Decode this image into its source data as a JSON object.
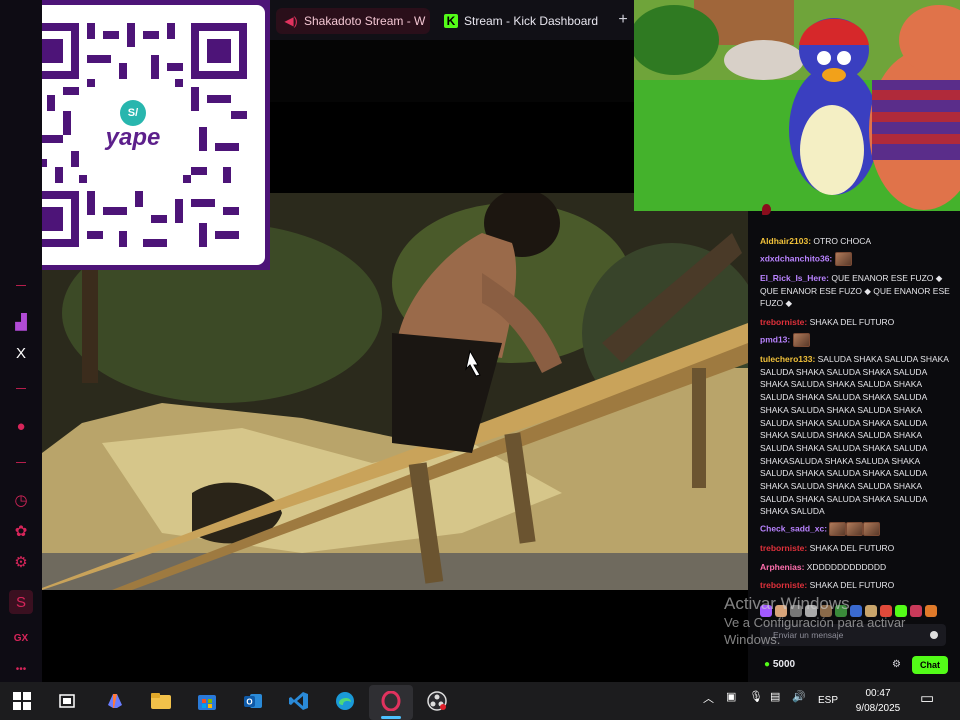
{
  "browser": {
    "tabs": [
      {
        "label": "Shakadoto Stream - W",
        "icon": "speaker-icon",
        "active": true
      },
      {
        "label": "Stream - Kick Dashboard",
        "icon": "kick-icon",
        "active": false
      }
    ],
    "new_tab_symbol": "+",
    "sidebar": {
      "items": [
        {
          "icon": "twitch-icon",
          "symbol": "▟"
        },
        {
          "icon": "x-icon",
          "symbol": "𝕏"
        },
        {
          "icon": "record-icon",
          "symbol": "●"
        },
        {
          "icon": "history-icon",
          "symbol": "◷"
        },
        {
          "icon": "extensions-icon",
          "symbol": "✿"
        },
        {
          "icon": "settings-icon",
          "symbol": "⚙"
        },
        {
          "icon": "gx-corner-icon",
          "symbol": "S"
        },
        {
          "icon": "gx-icon",
          "symbol": "GX"
        },
        {
          "icon": "more-icon",
          "symbol": "•••"
        }
      ]
    }
  },
  "qr_overlay": {
    "brand": "yape",
    "badge_initials": "S/"
  },
  "chat": {
    "messages": [
      {
        "user": "Aldhair2103:",
        "text": " OTRO CHOCA",
        "color": "yellow"
      },
      {
        "user": "xdxdchanchito36:",
        "text": "",
        "color": "purple",
        "emote": true
      },
      {
        "user": "El_Rick_Is_Here:",
        "text": " QUE ENANOR ESE FUZO ◆ QUE ENANOR ESE FUZO ◆ QUE ENANOR ESE FUZO ◆",
        "color": "purple"
      },
      {
        "user": "treborniste:",
        "text": " SHAKA DEL FUTURO",
        "color": "red"
      },
      {
        "user": "pmd13:",
        "text": "",
        "color": "purple",
        "emote": true
      },
      {
        "user": "tulechero133:",
        "text": " SALUDA SHAKA SALUDA SHAKA SALUDA SHAKA SALUDA SHAKA SALUDA SHAKA SALUDA SHAKA SALUDA SHAKA SALUDA SHAKA SALUDA SHAKA SALUDA SHAKA SALUDA SHAKA SALUDA SHAKA SALUDA SHAKA SALUDA SHAKA SALUDA SHAKA SALUDA SHAKA SALUDA SHAKA SALUDA SHAKA SALUDA SHAKA SALUDA SHAKASALUDA SHAKA SALUDA SHAKA SALUDA SHAKA SALUDA SHAKA SALUDA SHAKA SALUDA SHAKA SALUDA SHAKA SALUDA SHAKA SALUDA SHAKA SALUDA SHAKA SALUDA",
        "color": "yellow"
      },
      {
        "user": "Check_sadd_xc:",
        "text": "",
        "color": "purple",
        "emote": true
      },
      {
        "user": "treborniste:",
        "text": " SHAKA DEL FUTURO",
        "color": "red"
      },
      {
        "user": "Arphenias:",
        "text": " XDDDDDDDDDDDD",
        "color": "pink"
      },
      {
        "user": "treborniste:",
        "text": " SHAKA DEL FUTURO",
        "color": "red"
      }
    ],
    "input_placeholder": "Enviar un mensaje",
    "points_value": "5000",
    "chat_button": "Chat",
    "colors": {
      "kick_green": "#53fc18",
      "chat_bg": "#0b0b0e"
    }
  },
  "watermark": {
    "line1": "Activar Windows",
    "line2": "Ve a Configuración para activar",
    "line3": "Windows."
  },
  "taskbar": {
    "apps": [
      "windows-start-icon",
      "task-view-icon",
      "copilot-icon",
      "file-explorer-icon",
      "store-icon",
      "outlook-icon",
      "vscode-icon",
      "edge-icon",
      "opera-gx-icon",
      "obs-icon"
    ],
    "tray": {
      "language": "ESP"
    },
    "clock": {
      "time": "00:47",
      "date": "9/08/2025"
    }
  }
}
